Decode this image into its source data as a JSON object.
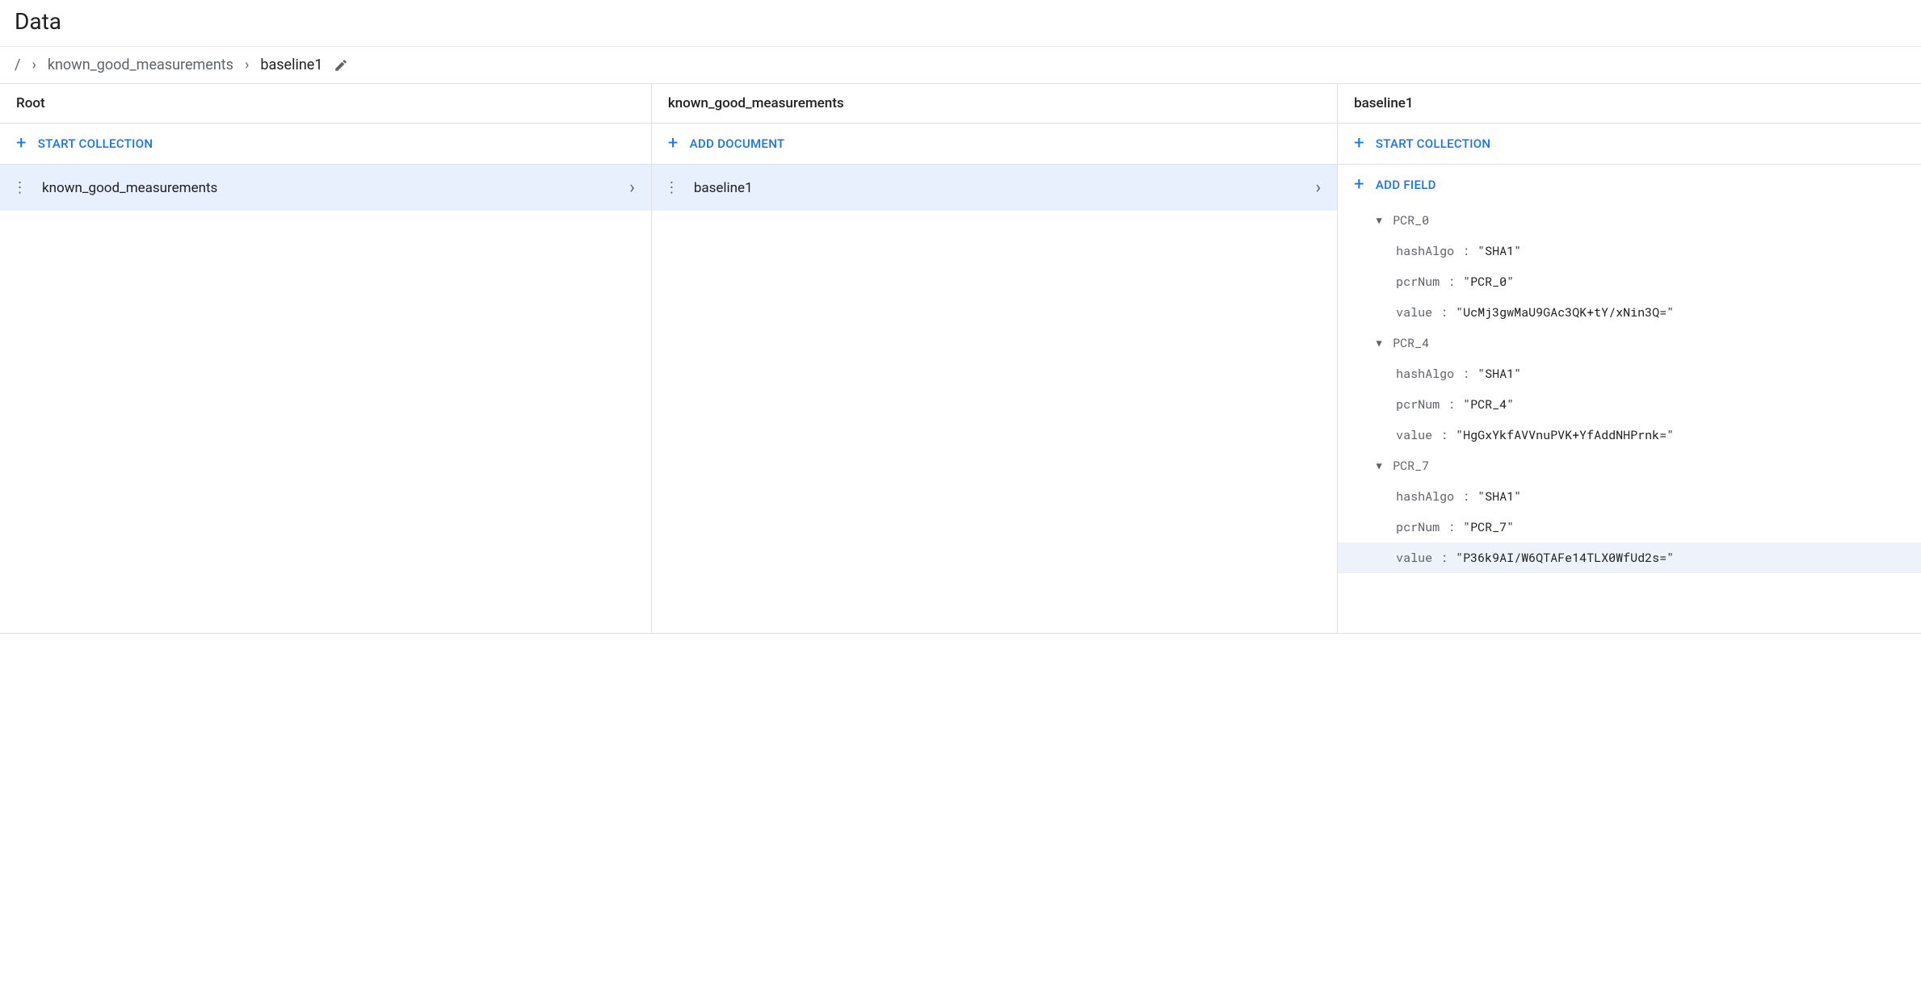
{
  "page_title": "Data",
  "breadcrumb": {
    "root": "/",
    "collection": "known_good_measurements",
    "document": "baseline1"
  },
  "col_root": {
    "header": "Root",
    "action": "START COLLECTION",
    "items": [
      {
        "label": "known_good_measurements",
        "selected": true
      }
    ]
  },
  "col_collection": {
    "header": "known_good_measurements",
    "action": "ADD DOCUMENT",
    "items": [
      {
        "label": "baseline1",
        "selected": true
      }
    ]
  },
  "col_document": {
    "header": "baseline1",
    "action_collection": "START COLLECTION",
    "action_field": "ADD FIELD",
    "fields": [
      {
        "name": "PCR_0",
        "children": [
          {
            "key": "hashAlgo",
            "value": "\"SHA1\""
          },
          {
            "key": "pcrNum",
            "value": "\"PCR_0\""
          },
          {
            "key": "value",
            "value": "\"UcMj3gwMaU9GAc3QK+tY/xNin3Q=\""
          }
        ]
      },
      {
        "name": "PCR_4",
        "children": [
          {
            "key": "hashAlgo",
            "value": "\"SHA1\""
          },
          {
            "key": "pcrNum",
            "value": "\"PCR_4\""
          },
          {
            "key": "value",
            "value": "\"HgGxYkfAVVnuPVK+YfAddNHPrnk=\""
          }
        ]
      },
      {
        "name": "PCR_7",
        "children": [
          {
            "key": "hashAlgo",
            "value": "\"SHA1\""
          },
          {
            "key": "pcrNum",
            "value": "\"PCR_7\""
          },
          {
            "key": "value",
            "value": "\"P36k9AI/W6QTAFe14TLX0WfUd2s=\"",
            "highlight": true
          }
        ]
      }
    ]
  }
}
